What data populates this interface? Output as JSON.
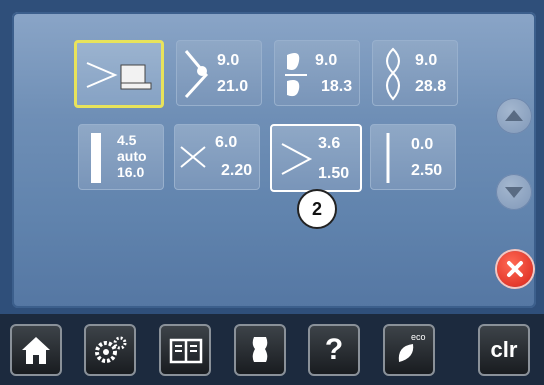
{
  "tiles": [
    {
      "name": "tile-stitch-selector",
      "top": "",
      "bottom": ""
    },
    {
      "name": "tile-zigzag",
      "top": "9.0",
      "bottom": "21.0"
    },
    {
      "name": "tile-satin",
      "top": "9.0",
      "bottom": "18.3"
    },
    {
      "name": "tile-leaf",
      "top": "9.0",
      "bottom": "28.8"
    },
    {
      "name": "tile-buttonhole",
      "top": "4.5",
      "mid": "auto",
      "bottom": "16.0"
    },
    {
      "name": "tile-width-length",
      "top": "6.0",
      "bottom": "2.20"
    },
    {
      "name": "tile-active",
      "top": "3.6",
      "bottom": "1.50"
    },
    {
      "name": "tile-straight",
      "top": "0.0",
      "bottom": "2.50"
    }
  ],
  "callout_label": "2",
  "toolbar": {
    "clr_label": "clr",
    "eco_label": "eco",
    "help_label": "?"
  },
  "colors": {
    "selected_yellow": "#e8e35b",
    "close_red": "#d8241a"
  }
}
